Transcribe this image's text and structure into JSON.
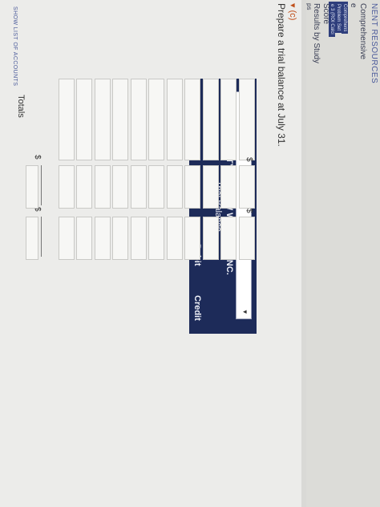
{
  "sidebar": {
    "heading": "NENT RESOURCES",
    "comprehensive": "Comprehensive",
    "score": "Score",
    "results": "Results by Study",
    "fragment_e": "e",
    "fragment_ps": "ps",
    "box_lines": [
      "Comprehens",
      "Problem Set",
      "e 3 (ROI Calci",
      "...",
      "Pr..."
    ]
  },
  "main": {
    "part_label": "(c)",
    "instruction": "Prepare a trial balance at July 31.",
    "company": "MONTY WINDOW WASHING INC.",
    "statement": "Trial Balance",
    "company_select_value": "",
    "debit_header": "Debit",
    "credit_header": "Credit",
    "currency_symbol": "$",
    "totals_label": "Totals",
    "show_list_label": "SHOW LIST OF ACCOUNTS"
  },
  "rows": [
    {
      "account": "",
      "debit": "",
      "credit": ""
    },
    {
      "account": "",
      "debit": "",
      "credit": ""
    },
    {
      "account": "",
      "debit": "",
      "credit": ""
    },
    {
      "account": "",
      "debit": "",
      "credit": ""
    },
    {
      "account": "",
      "debit": "",
      "credit": ""
    },
    {
      "account": "",
      "debit": "",
      "credit": ""
    },
    {
      "account": "",
      "debit": "",
      "credit": ""
    },
    {
      "account": "",
      "debit": "",
      "credit": ""
    },
    {
      "account": "",
      "debit": "",
      "credit": ""
    },
    {
      "account": "",
      "debit": "",
      "credit": ""
    },
    {
      "account": "",
      "debit": "",
      "credit": ""
    }
  ],
  "totals": {
    "debit": "",
    "credit": ""
  },
  "colors": {
    "banner": "#1d2b59",
    "part_accent": "#c0501b",
    "sidebar_box": "#2e3e7c"
  }
}
